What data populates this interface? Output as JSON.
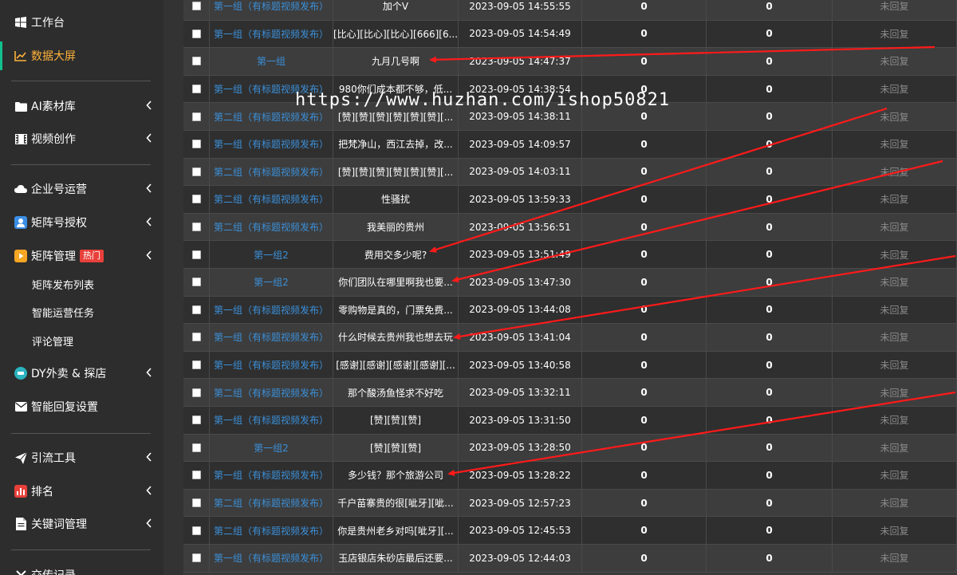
{
  "sidebar": {
    "items": [
      {
        "label": "工作台",
        "icon": "windows-icon",
        "chevron": false
      },
      {
        "label": "数据大屏",
        "icon": "chart-line-icon",
        "chevron": false
      },
      {
        "label": "AI素材库",
        "icon": "folder-icon",
        "chevron": true
      },
      {
        "label": "视频创作",
        "icon": "film-icon",
        "chevron": true
      },
      {
        "label": "企业号运营",
        "icon": "cloud-icon",
        "chevron": true
      },
      {
        "label": "矩阵号授权",
        "icon": "user-square-icon",
        "chevron": true
      },
      {
        "label": "矩阵管理",
        "icon": "play-square-icon",
        "chevron": true,
        "badge": "热门"
      },
      {
        "label": "DY外卖 & 探店",
        "icon": "circle-icon",
        "chevron": true
      },
      {
        "label": "智能回复设置",
        "icon": "envelope-icon",
        "chevron": false
      },
      {
        "label": "引流工具",
        "icon": "send-icon",
        "chevron": true
      },
      {
        "label": "排名",
        "icon": "bar-chart-icon",
        "chevron": true
      },
      {
        "label": "关键词管理",
        "icon": "file-icon",
        "chevron": true
      },
      {
        "label": "交传记录",
        "icon": "x-icon",
        "chevron": false
      }
    ],
    "sub_items": [
      "矩阵发布列表",
      "智能运营任务",
      "评论管理"
    ]
  },
  "watermark": "https://www.huzhan.com/ishop50821",
  "colors": {
    "accent": "#11c08d",
    "active_text": "#ffb23a",
    "link": "#3b8fd8",
    "badge": "#e8403a",
    "arrow": "#ff1a1a"
  },
  "rows": [
    {
      "group": "第一组（有标题视频发布）",
      "content": "加个V",
      "time": "2023-09-05 14:55:55",
      "n1": "0",
      "n2": "0",
      "status": "未回复"
    },
    {
      "group": "第一组（有标题视频发布）",
      "content": "[比心][比心][比心][666][6...",
      "time": "2023-09-05 14:54:49",
      "n1": "0",
      "n2": "0",
      "status": "未回复"
    },
    {
      "group": "第一组",
      "content": "九月几号啊",
      "time": "2023-09-05 14:47:37",
      "n1": "0",
      "n2": "0",
      "status": "未回复"
    },
    {
      "group": "第一组（有标题视频发布）",
      "content": "980你们成本都不够，低...",
      "time": "2023-09-05 14:38:54",
      "n1": "0",
      "n2": "0",
      "status": "未回复"
    },
    {
      "group": "第二组（有标题视频发布）",
      "content": "[赞][赞][赞][赞][赞][赞][...",
      "time": "2023-09-05 14:38:11",
      "n1": "0",
      "n2": "0",
      "status": "未回复"
    },
    {
      "group": "第一组（有标题视频发布）",
      "content": "把梵净山，西江去掉，改...",
      "time": "2023-09-05 14:09:57",
      "n1": "0",
      "n2": "0",
      "status": "未回复"
    },
    {
      "group": "第二组（有标题视频发布）",
      "content": "[赞][赞][赞][赞][赞][赞][...",
      "time": "2023-09-05 14:03:11",
      "n1": "0",
      "n2": "0",
      "status": "未回复"
    },
    {
      "group": "第二组（有标题视频发布）",
      "content": "性骚扰",
      "time": "2023-09-05 13:59:33",
      "n1": "0",
      "n2": "0",
      "status": "未回复"
    },
    {
      "group": "第二组（有标题视频发布）",
      "content": "我美丽的贵州",
      "time": "2023-09-05 13:56:51",
      "n1": "0",
      "n2": "0",
      "status": "未回复"
    },
    {
      "group": "第一组2",
      "content": "费用交多少呢?",
      "time": "2023-09-05 13:51:49",
      "n1": "0",
      "n2": "0",
      "status": "未回复"
    },
    {
      "group": "第一组2",
      "content": "你们团队在哪里啊我也要...",
      "time": "2023-09-05 13:47:30",
      "n1": "0",
      "n2": "0",
      "status": "未回复"
    },
    {
      "group": "第一组（有标题视频发布）",
      "content": "零购物是真的，门票免费...",
      "time": "2023-09-05 13:44:08",
      "n1": "0",
      "n2": "0",
      "status": "未回复"
    },
    {
      "group": "第一组（有标题视频发布）",
      "content": "什么时候去贵州我也想去玩",
      "time": "2023-09-05 13:41:04",
      "n1": "0",
      "n2": "0",
      "status": "未回复"
    },
    {
      "group": "第一组（有标题视频发布）",
      "content": "[感谢][感谢][感谢][感谢][...",
      "time": "2023-09-05 13:40:58",
      "n1": "0",
      "n2": "0",
      "status": "未回复"
    },
    {
      "group": "第二组（有标题视频发布）",
      "content": "那个酸汤鱼怪求不好吃",
      "time": "2023-09-05 13:32:11",
      "n1": "0",
      "n2": "0",
      "status": "未回复"
    },
    {
      "group": "第一组（有标题视频发布）",
      "content": "[赞][赞][赞]",
      "time": "2023-09-05 13:31:50",
      "n1": "0",
      "n2": "0",
      "status": "未回复"
    },
    {
      "group": "第一组2",
      "content": "[赞][赞][赞]",
      "time": "2023-09-05 13:28:50",
      "n1": "0",
      "n2": "0",
      "status": "未回复"
    },
    {
      "group": "第一组（有标题视频发布）",
      "content": "多少钱？那个旅游公司",
      "time": "2023-09-05 13:28:22",
      "n1": "0",
      "n2": "0",
      "status": "未回复"
    },
    {
      "group": "第二组（有标题视频发布）",
      "content": "千户苗寨贵的很[呲牙][呲...",
      "time": "2023-09-05 12:57:23",
      "n1": "0",
      "n2": "0",
      "status": "未回复"
    },
    {
      "group": "第二组（有标题视频发布）",
      "content": "你是贵州老乡对吗[呲牙][...",
      "time": "2023-09-05 12:45:53",
      "n1": "0",
      "n2": "0",
      "status": "未回复"
    },
    {
      "group": "第一组（有标题视频发布）",
      "content": "玉店银店朱砂店最后还要...",
      "time": "2023-09-05 12:44:03",
      "n1": "0",
      "n2": "0",
      "status": "未回复"
    }
  ]
}
